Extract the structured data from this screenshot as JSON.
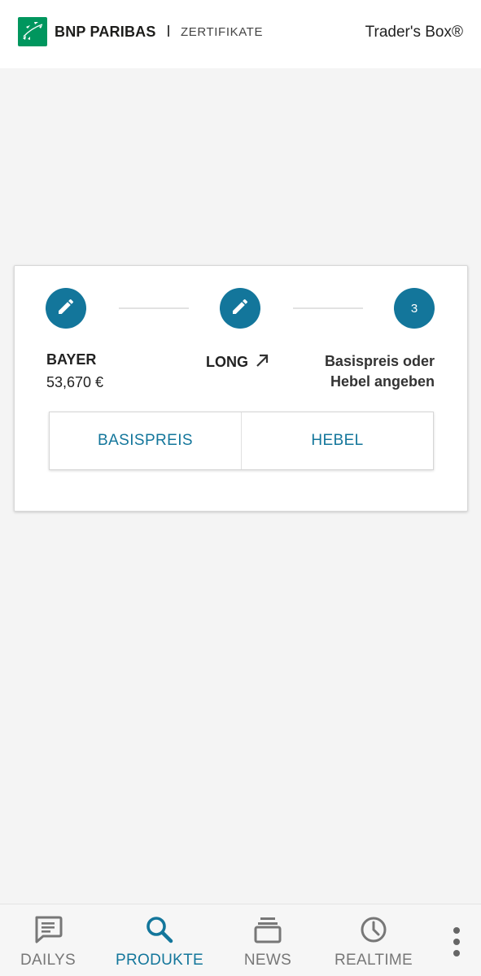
{
  "header": {
    "brand": "BNP PARIBAS",
    "brand_sub": "ZERTIFIKATE",
    "app_name": "Trader's Box®",
    "logo_icon": "bnp-stars-logo",
    "brand_color": "#00965e"
  },
  "stepper": {
    "accent_color": "#13769b",
    "steps": [
      {
        "icon": "pencil-icon",
        "title": "BAYER",
        "value": "53,670 €"
      },
      {
        "icon": "pencil-icon",
        "title": "LONG",
        "direction_icon": "arrow-up-right-icon"
      },
      {
        "number": "3",
        "title": "Basispreis oder Hebel angeben"
      }
    ]
  },
  "options": {
    "basispreis_label": "BASISPREIS",
    "hebel_label": "HEBEL"
  },
  "bottom_nav": {
    "items": [
      {
        "label": "DAILYS",
        "icon": "chat-icon",
        "active": false
      },
      {
        "label": "PRODUKTE",
        "icon": "search-icon",
        "active": true
      },
      {
        "label": "NEWS",
        "icon": "stack-icon",
        "active": false
      },
      {
        "label": "REALTIME",
        "icon": "clock-icon",
        "active": false
      }
    ],
    "more_icon": "more-vertical-icon"
  }
}
